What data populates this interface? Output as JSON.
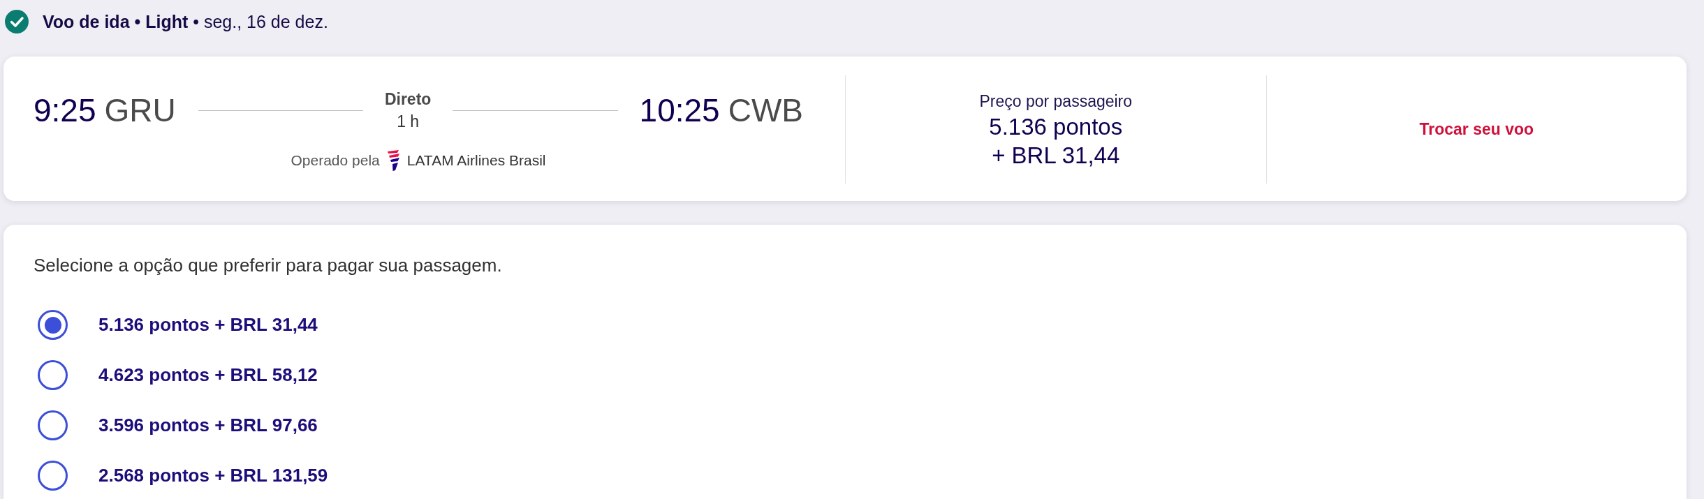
{
  "step": {
    "title": "**Voo de ida • Light** • seg., 16 de dez."
  },
  "flight": {
    "departure": {
      "time": "9:25",
      "airport": "GRU"
    },
    "connection": "Direto",
    "duration": "1 h",
    "arrival": {
      "time": "10:25",
      "airport": "CWB"
    },
    "operated_by": "Operado pela",
    "airline": "LATAM Airlines Brasil"
  },
  "price": {
    "label": "Preço por passageiro",
    "points": "5.136 pontos",
    "cash": "+ BRL 31,44"
  },
  "change_flight": {
    "label": "Trocar seu voo"
  },
  "payment": {
    "prompt": "Selecione a opção que preferir para pagar sua passagem.",
    "options": [
      {
        "label": "5.136 pontos + BRL 31,44",
        "selected": true
      },
      {
        "label": "4.623 pontos + BRL 58,12",
        "selected": false
      },
      {
        "label": "3.596 pontos + BRL 97,66",
        "selected": false
      },
      {
        "label": "2.568 pontos + BRL 131,59",
        "selected": false
      }
    ]
  }
}
